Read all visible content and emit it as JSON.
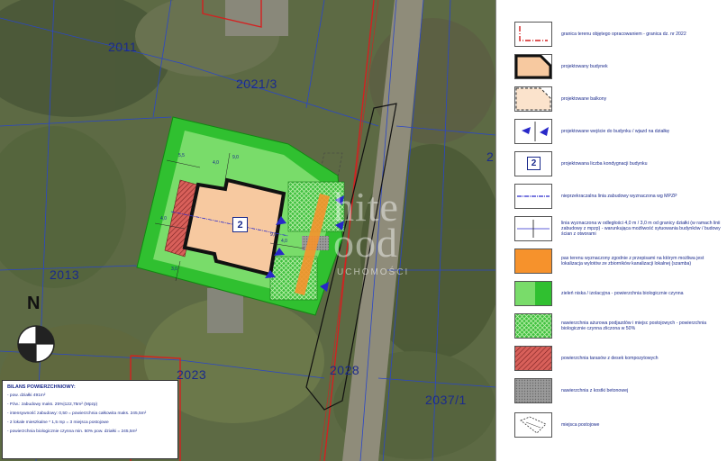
{
  "map": {
    "parcel_labels": [
      "2011",
      "2021/3",
      "2013",
      "2023",
      "2028",
      "2037/1",
      "2"
    ],
    "building_number": "2",
    "north_label": "N",
    "dimensions": [
      "5,5",
      "4,0",
      "9,0",
      "4,0",
      "3,0",
      "4,0",
      "9,0"
    ]
  },
  "watermark": {
    "line1": "hite",
    "line2": "ood",
    "line3": "UCHOMOŚCI"
  },
  "balance": {
    "title": "BILANS POWIERZCHNIOWY:",
    "items": [
      "- pow. działki 491m²",
      "- Pżw.: zabudowy maks. 25%|122,75m² (Mpzp)",
      "- intensywność zabudowy: 0,50 = powierzchnia całkowita maks. 245,5m²",
      "- 2 lokale mieszkalne * 1,5 mp = 3 miejsca postojowe",
      "- powierzchnia biologicznie czynna min. 50% pow. działki = 245,5m²"
    ]
  },
  "legend": {
    "items": [
      "granica terenu objętego opracowaniem - granica dz. nr 2022",
      "projektowany budynek",
      "projektowane balkony",
      "projektowane wejście do budynku / wjazd na działkę",
      "projektowana liczba kondygnacji budynku",
      "nieprzekraczalna linia zabudowy wyznaczona wg MPZP",
      "linia wyznaczona w odległości 4,0 m / 3,0 m od granicy działki (w ramach linii zabudowy z mpzp) - warunkująca możliwość sytuowania budynków / budowy ścian z otworami",
      "pas terenu wyznaczony zgodnie z przepisami na którym możliwa jest lokalizacja wylotów ze zbiorników kanalizacji lokalnej (szamba)",
      "zieleń niska / izolacyjna - powierzchnia biologicznie czynna",
      "nawierzchnia ażurowa podjazdów i miejsc postojowych - powierzchnia biologicznie czynna zliczona w 50%",
      "powierzchnia tarasów z desek kompozytowych",
      "nawierzchnia z kostki betonowej",
      "miejsca postojowe"
    ],
    "storey_number": "2"
  }
}
